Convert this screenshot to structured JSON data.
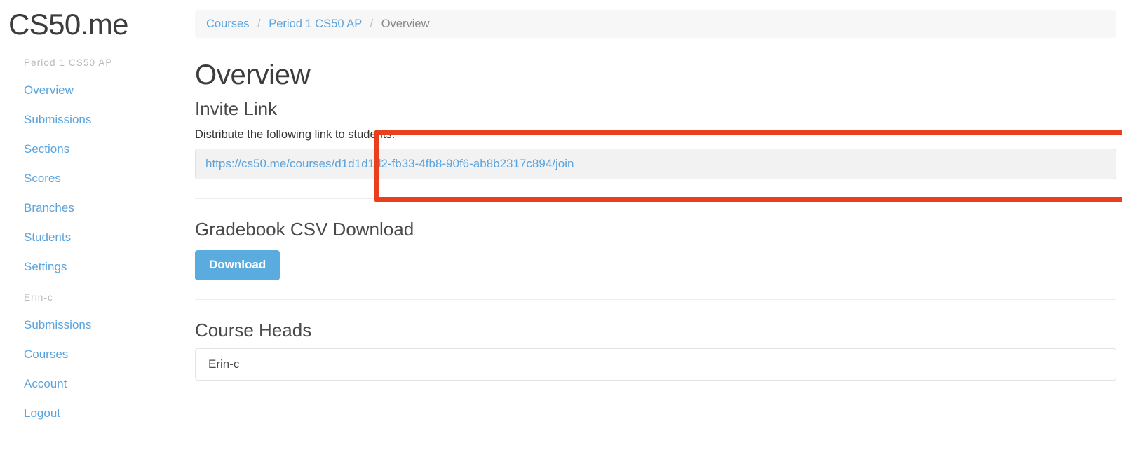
{
  "brand": {
    "title": "CS50.me"
  },
  "sidebar": {
    "groups": [
      {
        "header": "Period 1 CS50 AP",
        "items": [
          {
            "label": "Overview"
          },
          {
            "label": "Submissions"
          },
          {
            "label": "Sections"
          },
          {
            "label": "Scores"
          },
          {
            "label": "Branches"
          },
          {
            "label": "Students"
          },
          {
            "label": "Settings"
          }
        ]
      },
      {
        "header": "Erin-c",
        "items": [
          {
            "label": "Submissions"
          },
          {
            "label": "Courses"
          },
          {
            "label": "Account"
          },
          {
            "label": "Logout"
          }
        ]
      }
    ]
  },
  "breadcrumb": {
    "items": [
      {
        "label": "Courses",
        "current": false
      },
      {
        "label": "Period 1 CS50 AP",
        "current": false
      },
      {
        "label": "Overview",
        "current": true
      }
    ],
    "separator": "/"
  },
  "main": {
    "page_title": "Overview",
    "invite": {
      "section_title": "Invite Link",
      "instruction": "Distribute the following link to students:",
      "url": "https://cs50.me/courses/d1d1d1d2-fb33-4fb8-90f6-ab8b2317c894/join"
    },
    "gradebook": {
      "section_title": "Gradebook CSV Download",
      "download_label": "Download"
    },
    "course_heads": {
      "section_title": "Course Heads",
      "value": "Erin-c"
    }
  },
  "colors": {
    "link_blue": "#5ba4dd",
    "button_blue": "#5aabde",
    "annotation_red": "#e8401f",
    "breadcrumb_bg": "#f7f7f7",
    "readonly_bg": "#f2f2f2",
    "heading_gray": "#3d3d3d",
    "muted_gray": "#b9b9b9"
  }
}
